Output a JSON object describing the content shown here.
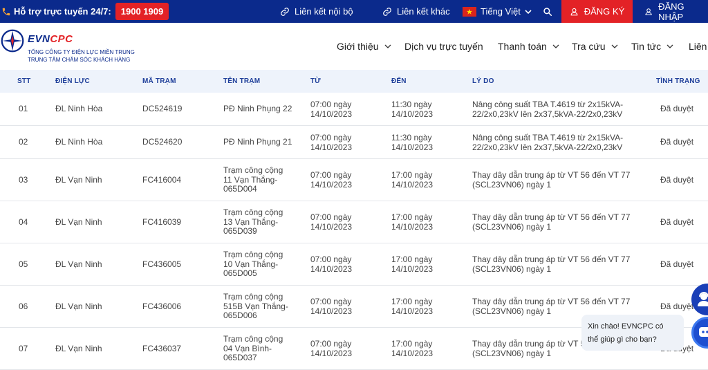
{
  "topbar": {
    "hotline_label": "Hỗ trợ trực tuyến 24/7:",
    "hotline_number": "1900 1909",
    "link_internal": "Liên kết nội bộ",
    "link_other": "Liên kết khác",
    "language": "Tiếng Việt",
    "register": "ĐĂNG KÝ",
    "login": "ĐĂNG NHẬP"
  },
  "header": {
    "brand_a": "EVN",
    "brand_b": "CPC",
    "subtitle_1": "TỔNG CÔNG TY ĐIỆN LỰC MIỀN TRUNG",
    "subtitle_2": "TRUNG TÂM CHĂM SÓC KHÁCH HÀNG",
    "nav": [
      {
        "label": "Giới thiệu"
      },
      {
        "label": "Dịch vụ trực tuyến"
      },
      {
        "label": "Thanh toán"
      },
      {
        "label": "Tra cứu"
      },
      {
        "label": "Tin tức"
      },
      {
        "label": "Liên"
      }
    ]
  },
  "table": {
    "headers": [
      "STT",
      "ĐIỆN LỰC",
      "MÃ TRẠM",
      "TÊN TRẠM",
      "TỪ",
      "ĐẾN",
      "LÝ DO",
      "TÌNH TRẠNG"
    ],
    "rows": [
      {
        "stt": "01",
        "dl": "ĐL Ninh Hòa",
        "ma": "DC524619",
        "ten": [
          "PĐ Ninh Phụng 22"
        ],
        "tu": [
          "07:00 ngày",
          "14/10/2023"
        ],
        "den": [
          "11:30 ngày",
          "14/10/2023"
        ],
        "lydo": [
          "Nâng công suất TBA T.4619 từ 2x15kVA-",
          "22/2x0,23kV lên 2x37,5kVA-22/2x0,23kV"
        ],
        "tt": "Đã duyệt"
      },
      {
        "stt": "02",
        "dl": "ĐL Ninh Hòa",
        "ma": "DC524620",
        "ten": [
          "PĐ Ninh Phụng 21"
        ],
        "tu": [
          "07:00 ngày",
          "14/10/2023"
        ],
        "den": [
          "11:30 ngày",
          "14/10/2023"
        ],
        "lydo": [
          "Nâng công suất TBA T.4619 từ 2x15kVA-",
          "22/2x0,23kV lên 2x37,5kVA-22/2x0,23kV"
        ],
        "tt": "Đã duyệt"
      },
      {
        "stt": "03",
        "dl": "ĐL Vạn Ninh",
        "ma": "FC416004",
        "ten": [
          "Trạm công cộng",
          "11 Vạn Thắng-",
          "065D004"
        ],
        "tu": [
          "07:00 ngày",
          "14/10/2023"
        ],
        "den": [
          "17:00 ngày",
          "14/10/2023"
        ],
        "lydo": [
          "Thay dây dẫn trung áp từ VT 56 đến VT 77",
          "(SCL23VN06) ngày 1"
        ],
        "tt": "Đã duyệt"
      },
      {
        "stt": "04",
        "dl": "ĐL Vạn Ninh",
        "ma": "FC416039",
        "ten": [
          "Trạm công cộng",
          "13 Vạn Thắng-",
          "065D039"
        ],
        "tu": [
          "07:00 ngày",
          "14/10/2023"
        ],
        "den": [
          "17:00 ngày",
          "14/10/2023"
        ],
        "lydo": [
          "Thay dây dẫn trung áp từ VT 56 đến VT 77",
          "(SCL23VN06) ngày 1"
        ],
        "tt": "Đã duyệt"
      },
      {
        "stt": "05",
        "dl": "ĐL Vạn Ninh",
        "ma": "FC436005",
        "ten": [
          "Trạm công cộng",
          "10 Vạn Thắng-",
          "065D005"
        ],
        "tu": [
          "07:00 ngày",
          "14/10/2023"
        ],
        "den": [
          "17:00 ngày",
          "14/10/2023"
        ],
        "lydo": [
          "Thay dây dẫn trung áp từ VT 56 đến VT 77",
          "(SCL23VN06) ngày 1"
        ],
        "tt": "Đã duyệt"
      },
      {
        "stt": "06",
        "dl": "ĐL Vạn Ninh",
        "ma": "FC436006",
        "ten": [
          "Trạm công cộng",
          "515B Vạn Thắng-",
          "065D006"
        ],
        "tu": [
          "07:00 ngày",
          "14/10/2023"
        ],
        "den": [
          "17:00 ngày",
          "14/10/2023"
        ],
        "lydo": [
          "Thay dây dẫn trung áp từ VT 56 đến VT 77",
          "(SCL23VN06) ngày 1"
        ],
        "tt": "Đã duyệt"
      },
      {
        "stt": "07",
        "dl": "ĐL Vạn Ninh",
        "ma": "FC436037",
        "ten": [
          "Trạm công cộng",
          "04 Vạn Bình-",
          "065D037"
        ],
        "tu": [
          "07:00 ngày",
          "14/10/2023"
        ],
        "den": [
          "17:00 ngày",
          "14/10/2023"
        ],
        "lydo": [
          "Thay dây dẫn trung áp từ VT 5",
          "(SCL23VN06) ngày 1"
        ],
        "tt": "Đã duyệt"
      }
    ]
  },
  "chat": {
    "line1": "Xin chào! EVNCPC có",
    "line2": "thể giúp gì cho bạn?"
  },
  "colors": {
    "navy": "#0b2a8c",
    "red": "#e32226",
    "header_blue": "#1f3f9a"
  }
}
